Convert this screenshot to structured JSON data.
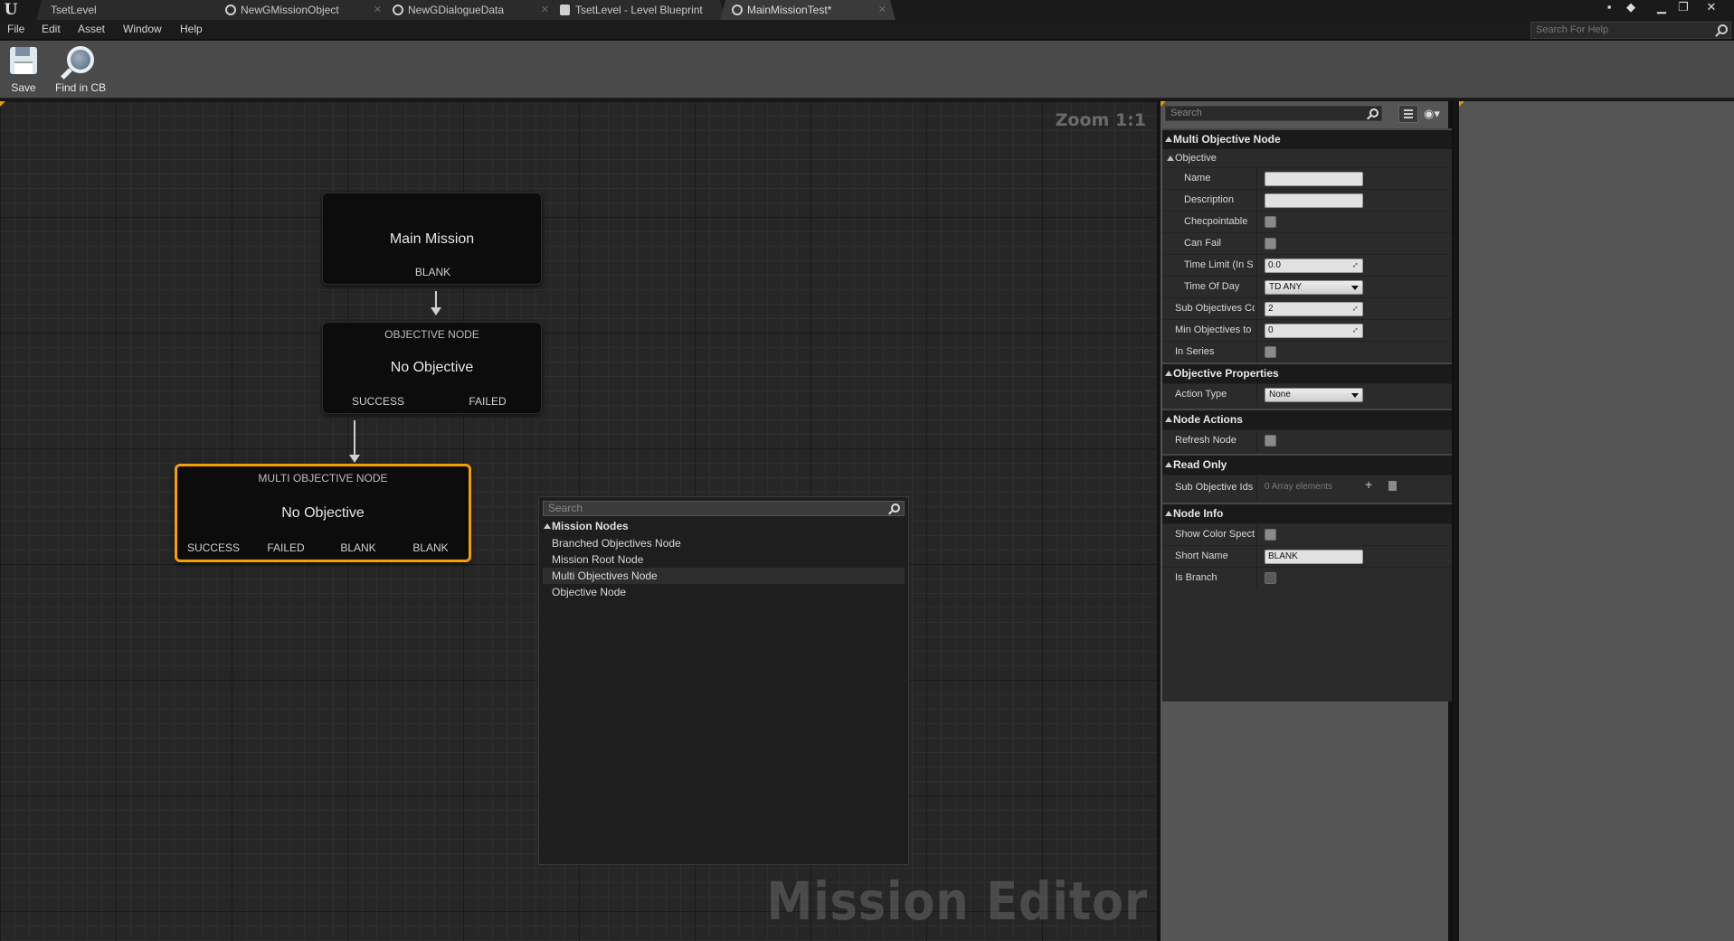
{
  "tabs": [
    {
      "label": "TsetLevel",
      "icon": "level-icon"
    },
    {
      "label": "NewGMissionObject",
      "icon": "asset-icon"
    },
    {
      "label": "NewGDialogueData",
      "icon": "asset-icon"
    },
    {
      "label": "TsetLevel - Level Blueprint",
      "icon": "blueprint-icon"
    },
    {
      "label": "MainMissionTest*",
      "icon": "asset-icon",
      "active": true
    }
  ],
  "menu": [
    "File",
    "Edit",
    "Asset",
    "Window",
    "Help"
  ],
  "help_search": {
    "placeholder": "Search For Help"
  },
  "toolbar": {
    "save_label": "Save",
    "find_label": "Find in CB"
  },
  "graph": {
    "zoom": "Zoom 1:1",
    "watermark": "Mission Editor",
    "nodes": {
      "main": {
        "title": "Main Mission",
        "pins": [
          "BLANK"
        ]
      },
      "objective": {
        "header": "OBJECTIVE NODE",
        "title": "No Objective",
        "pins": [
          "SUCCESS",
          "FAILED"
        ]
      },
      "multi": {
        "header": "MULTI OBJECTIVE NODE",
        "title": "No Objective",
        "pins": [
          "SUCCESS",
          "FAILED",
          "BLANK",
          "BLANK"
        ]
      }
    }
  },
  "context_menu": {
    "search_placeholder": "Search",
    "category": "Mission Nodes",
    "items": [
      "Branched Objectives Node",
      "Mission Root Node",
      "Multi Objectives Node",
      "Objective Node"
    ],
    "highlighted_index": 2
  },
  "details": {
    "search_placeholder": "Search",
    "title": "Multi Objective Node",
    "objective": {
      "header": "Objective",
      "name_label": "Name",
      "name_value": "",
      "description_label": "Description",
      "description_value": "",
      "checkpointable_label": "Checpointable",
      "can_fail_label": "Can Fail",
      "time_limit_label": "Time Limit (In S",
      "time_limit_value": "0.0",
      "time_of_day_label": "Time Of Day",
      "time_of_day_value": "TD ANY",
      "sub_objectives_count_label": "Sub Objectives Co",
      "sub_objectives_count_value": "2",
      "min_objectives_label": "Min Objectives to",
      "min_objectives_value": "0",
      "in_series_label": "In Series"
    },
    "objective_properties": {
      "header": "Objective Properties",
      "action_type_label": "Action Type",
      "action_type_value": "None"
    },
    "node_actions": {
      "header": "Node Actions",
      "refresh_label": "Refresh Node"
    },
    "read_only": {
      "header": "Read Only",
      "sub_objective_ids_label": "Sub Objective Ids",
      "sub_objective_ids_value": "0 Array elements"
    },
    "node_info": {
      "header": "Node Info",
      "show_color_label": "Show Color Spect",
      "short_name_label": "Short Name",
      "short_name_value": "BLANK",
      "is_branch_label": "Is Branch"
    }
  },
  "colors": {
    "selection": "#f5a000",
    "graph_bg": "#262626",
    "panel_bg": "#555555"
  }
}
